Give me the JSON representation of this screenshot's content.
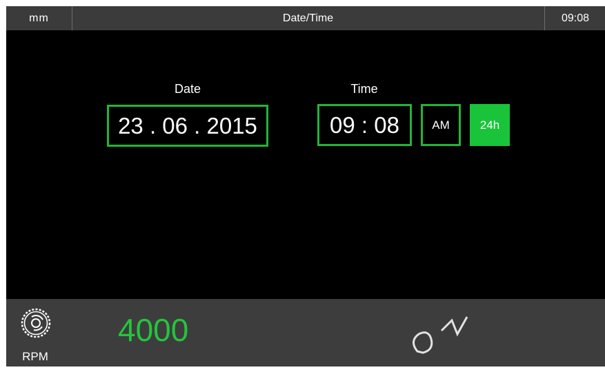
{
  "header": {
    "unit": "mm",
    "title": "Date/Time",
    "clock": "09:08"
  },
  "date": {
    "label": "Date",
    "value": "23 . 06 . 2015"
  },
  "time": {
    "label": "Time",
    "value": "09 : 08",
    "ampm_label": "AM",
    "format_24h_label": "24h",
    "selected_format": "24h"
  },
  "status": {
    "rpm_label": "RPM",
    "rpm_value": "4000",
    "rpm_icon": "saw-blade-icon"
  },
  "colors": {
    "accent_green": "#22b53a",
    "active_green": "#19c43a",
    "header_bg": "#3b3b3b",
    "screen_bg": "#000000",
    "bottom_bar_bg": "#3d3d3d"
  }
}
